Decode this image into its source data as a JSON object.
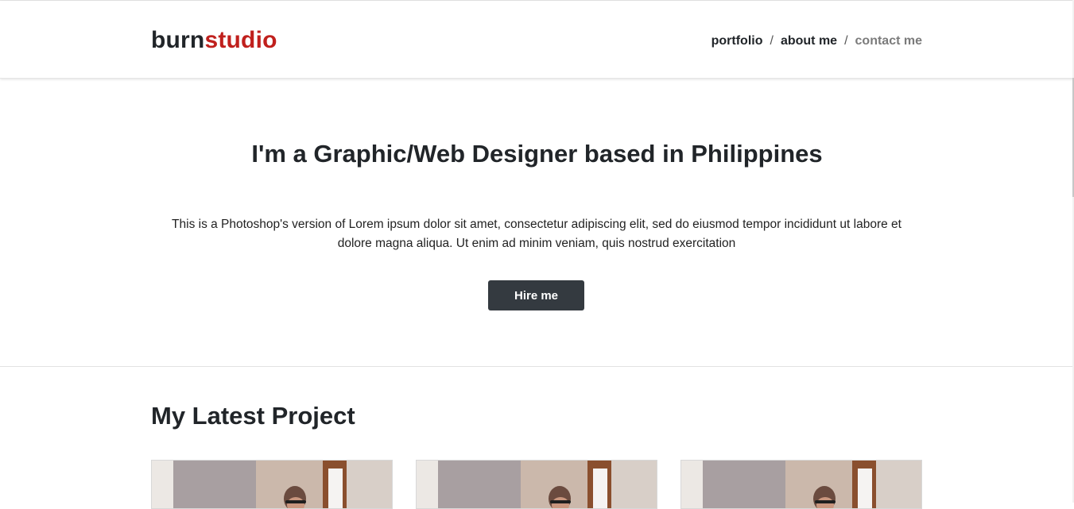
{
  "brand": {
    "part1": "burn",
    "part2": "studio",
    "accent_color": "#c0201d"
  },
  "nav": {
    "items": [
      {
        "label": "portfolio"
      },
      {
        "label": "about me"
      },
      {
        "label": "contact me"
      }
    ],
    "separator": "/"
  },
  "hero": {
    "title": "I'm a Graphic/Web Designer based in Philippines",
    "body": "This is a Photoshop's version of Lorem ipsum dolor sit amet, consectetur adipiscing elit, sed do eiusmod tempor incididunt ut labore et dolore magna aliqua. Ut enim ad minim veniam, quis nostrud exercitation",
    "cta_label": "Hire me"
  },
  "projects": {
    "heading": "My Latest Project",
    "cards": [
      {
        "image": "person-at-desk-photo"
      },
      {
        "image": "person-at-desk-photo"
      },
      {
        "image": "person-at-desk-photo"
      }
    ]
  }
}
